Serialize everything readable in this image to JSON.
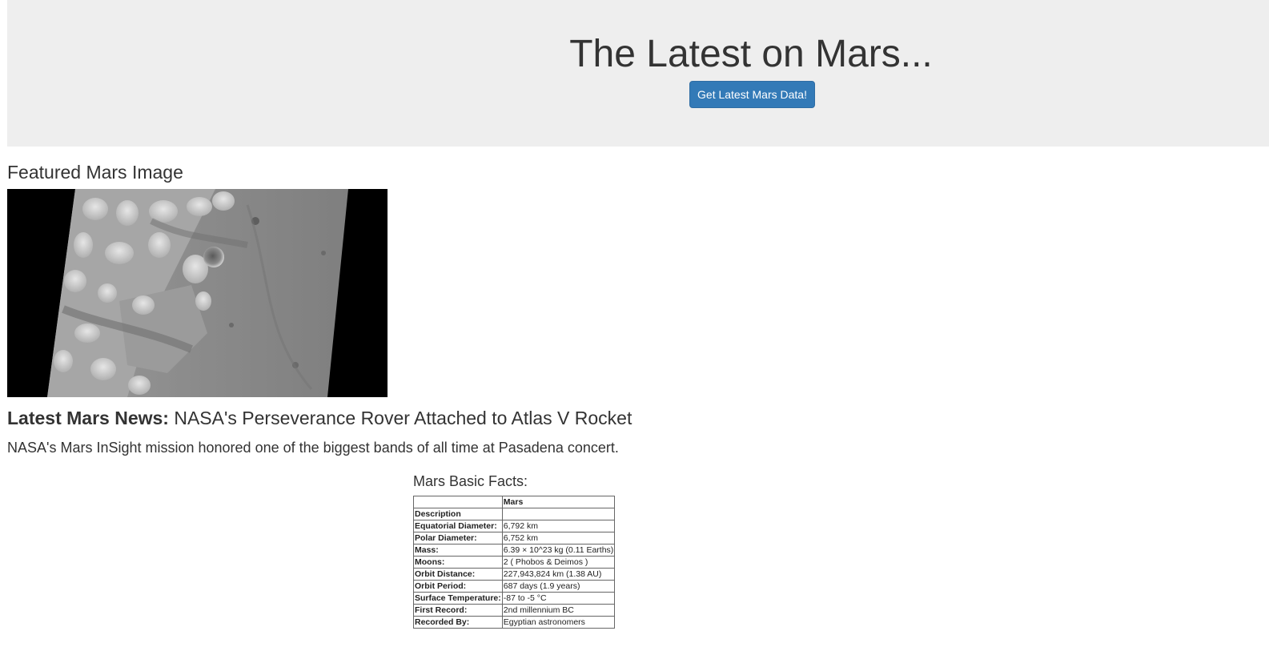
{
  "header": {
    "title": "The Latest on Mars...",
    "scrape_button_label": "Get Latest Mars Data!",
    "accent_color": "#337ab7"
  },
  "featured_image": {
    "heading": "Featured Mars Image",
    "alt": "Grayscale orbital image of the Martian surface"
  },
  "news": {
    "label": "Latest Mars News:",
    "title": "NASA's Perseverance Rover Attached to Atlas V Rocket",
    "teaser": "NASA's Mars InSight mission honored one of the biggest bands of all time at Pasadena concert."
  },
  "facts": {
    "heading": "Mars Basic Facts:",
    "column_header": "Mars",
    "index_header": "Description",
    "rows": [
      {
        "key": "Equatorial Diameter:",
        "value": "6,792 km"
      },
      {
        "key": "Polar Diameter:",
        "value": "6,752 km"
      },
      {
        "key": "Mass:",
        "value": "6.39 × 10^23 kg (0.11 Earths)"
      },
      {
        "key": "Moons:",
        "value": "2 ( Phobos & Deimos )"
      },
      {
        "key": "Orbit Distance:",
        "value": "227,943,824 km (1.38 AU)"
      },
      {
        "key": "Orbit Period:",
        "value": "687 days (1.9 years)"
      },
      {
        "key": "Surface Temperature:",
        "value": "-87 to -5 °C"
      },
      {
        "key": "First Record:",
        "value": "2nd millennium BC"
      },
      {
        "key": "Recorded By:",
        "value": "Egyptian astronomers"
      }
    ]
  }
}
